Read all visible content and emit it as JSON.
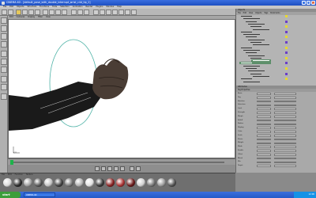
{
  "window": {
    "title": "CINEMA 4D - [default_pose_with_double_interrupt_wrist_c4d_tip_2]",
    "minimize_glyph": "_",
    "maximize_glyph": "□",
    "close_glyph": "×"
  },
  "menubar": {
    "items": [
      "File",
      "Edit",
      "Objects",
      "Structure",
      "Functions",
      "Tools",
      "Selection",
      "Animation",
      "Render",
      "Plugins",
      "Window",
      "Help"
    ]
  },
  "viewport": {
    "menu": [
      "Edit",
      "Cameras",
      "Display",
      "Filter",
      "View"
    ],
    "axis_label": "y x",
    "bg_color": "#ffffff",
    "ring_color": "#4fb3a7"
  },
  "objects_panel": {
    "title": "Objects",
    "menu": [
      "File",
      "Edit",
      "View",
      "Objects",
      "Tags",
      "Bookmarks"
    ]
  },
  "attributes_panel": {
    "title": "Attributes",
    "section": "Tag Properties",
    "rows": [
      "Basic",
      "Tag",
      "Rotation",
      "Selection",
      "Limit",
      "Strength",
      "Morph",
      "Falloff",
      "Radius",
      "Display",
      "Color",
      "Scale",
      "Points",
      "Weight",
      "Mode",
      "Enable",
      "Offset",
      "Blend",
      "Mix",
      "Target"
    ]
  },
  "materials": {
    "menu": [
      "File",
      "Edit",
      "Function",
      "Texture"
    ],
    "swatch_colors": [
      "#d9d9d9",
      "#2b2b2b",
      "#9e9e9e",
      "#5a5a5a",
      "#c2c2c2",
      "#444444",
      "#7a7a7a",
      "#b0b0b0",
      "#e0e0e0",
      "#3a3a3a",
      "#8a2222",
      "#a33",
      "#6b1a1a",
      "#cfcfcf",
      "#777777",
      "#999999",
      "#555555"
    ]
  },
  "taskbar": {
    "start_label": "start",
    "tasks": [
      "CINEMA 4D"
    ],
    "clock": "12:00"
  },
  "colors": {
    "accent_green": "#1db34a",
    "selected_row": "#5d8f6a",
    "tag_yellow": "#e8d830",
    "tag_violet": "#6a3ec8"
  }
}
